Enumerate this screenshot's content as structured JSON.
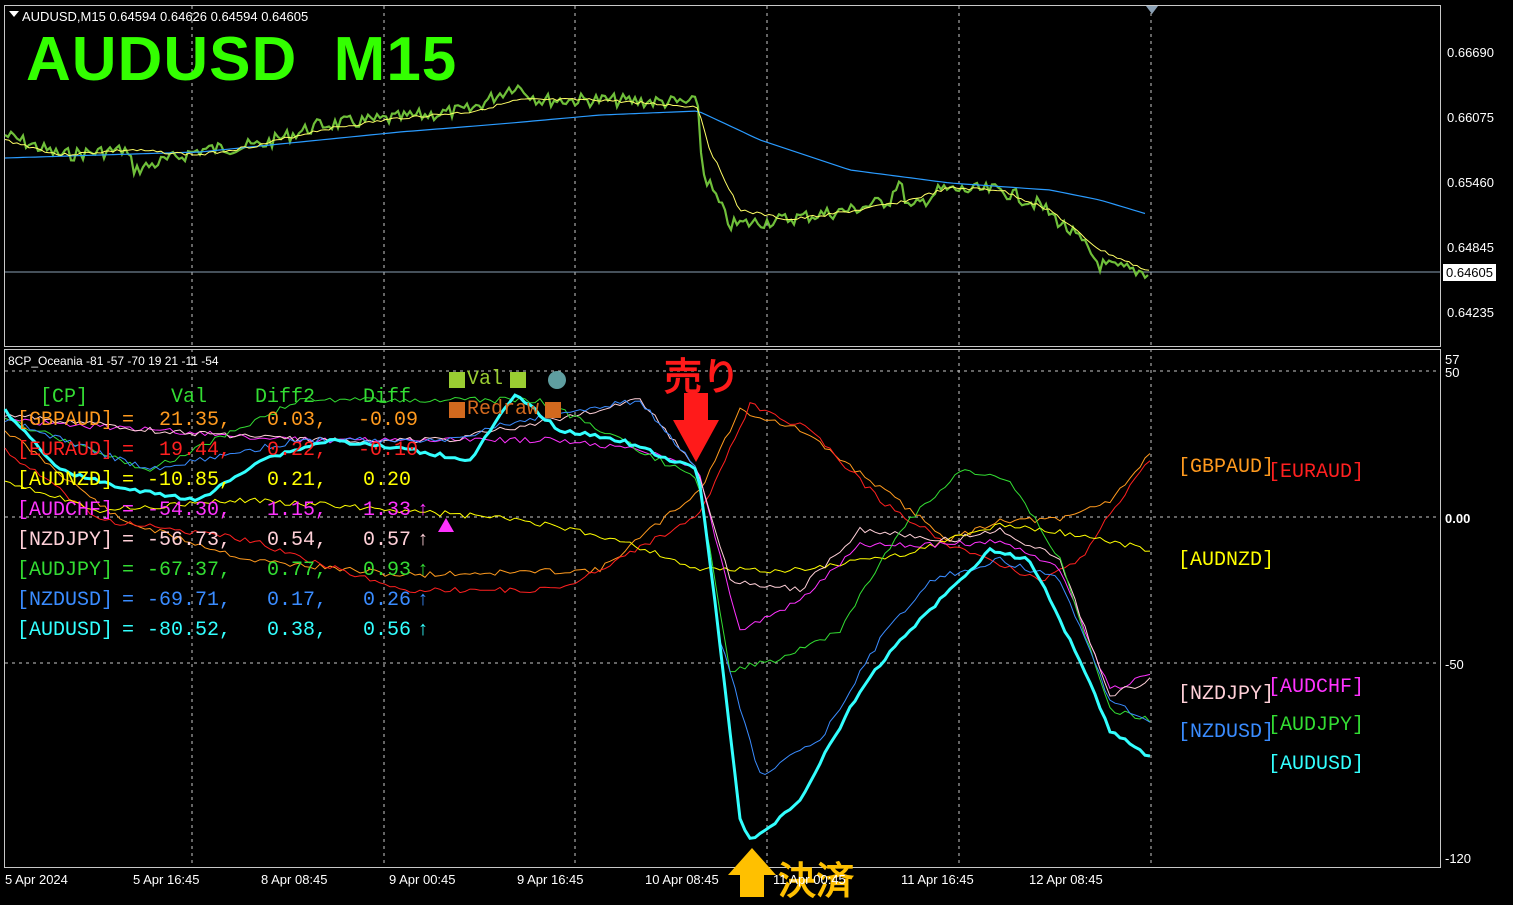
{
  "header": {
    "symbol_info": "AUDUSD,M15  0.64594 0.64626 0.64594 0.64605",
    "big_title": "AUDUSD  M15"
  },
  "price_axis": [
    "0.66690",
    "0.66075",
    "0.65460",
    "0.64845",
    "0.64235"
  ],
  "current_price": "0.64605",
  "indicator": {
    "title": "8CP_Oceania -81 -57 -70 19 21 -11 -54",
    "axis": [
      "57",
      "50",
      "0.00",
      "-50",
      "-120"
    ],
    "legend": {
      "val_label": "Val",
      "redraw_label": "Redraw"
    },
    "table_header": {
      "cp": "[CP]",
      "val": "Val",
      "diff2": "Diff2",
      "diff": "Diff"
    },
    "rows": [
      {
        "name": "[GBPAUD]",
        "val": "21.35,",
        "diff2": "0.03,",
        "diff": "-0.09",
        "arrow": "",
        "color": "#ff9a1e"
      },
      {
        "name": "[EURAUD]",
        "val": "19.44,",
        "diff2": "0.22,",
        "diff": "-0.10",
        "arrow": "",
        "color": "#ff2020"
      },
      {
        "name": "[AUDNZD]",
        "val": "-10.85,",
        "diff2": "0.21,",
        "diff": "0.20",
        "arrow": "",
        "color": "#ffff00"
      },
      {
        "name": "[AUDCHF]",
        "val": "-54.30,",
        "diff2": "1.15,",
        "diff": "1.33",
        "arrow": "↑",
        "color": "#ff33ff"
      },
      {
        "name": "[NZDJPY]",
        "val": "-56.73,",
        "diff2": "0.54,",
        "diff": "0.57",
        "arrow": "↑",
        "color": "#ffd0d8"
      },
      {
        "name": "[AUDJPY]",
        "val": "-67.37,",
        "diff2": "0.77,",
        "diff": "0.93",
        "arrow": "↑",
        "color": "#33dd33"
      },
      {
        "name": "[NZDUSD]",
        "val": "-69.71,",
        "diff2": "0.17,",
        "diff": "0.26",
        "arrow": "↑",
        "color": "#3a8cff"
      },
      {
        "name": "[AUDUSD]",
        "val": "-80.52,",
        "diff2": "0.38,",
        "diff": "0.56",
        "arrow": "↑",
        "color": "#33ffff"
      }
    ],
    "right_tags": {
      "gbpaud": "[GBPAUD]",
      "euraud": "[EURAUD]",
      "audnzd": "[AUDNZD]",
      "nzdjpy": "[NZDJPY]",
      "audchf": "[AUDCHF]",
      "nzdusd": "[NZDUSD]",
      "audjpy": "[AUDJPY]",
      "audusd": "[AUDUSD]"
    }
  },
  "annotations": {
    "sell": "売り",
    "settle": "決済"
  },
  "time_axis": [
    "5 Apr 2024",
    "5 Apr 16:45",
    "8 Apr 08:45",
    "9 Apr 00:45",
    "9 Apr 16:45",
    "10 Apr 08:45",
    "11 Apr 00:45",
    "11 Apr 16:45",
    "12 Apr 08:45"
  ],
  "colors": {
    "candles": "#6fbf3a",
    "fast_ma": "#ffff66",
    "slow_ma": "#2a9bff",
    "grid": "#c8c8c8",
    "title_green": "#33ff00",
    "sell_arrow": "#ff1a1a",
    "settle_arrow": "#ffc000"
  }
}
